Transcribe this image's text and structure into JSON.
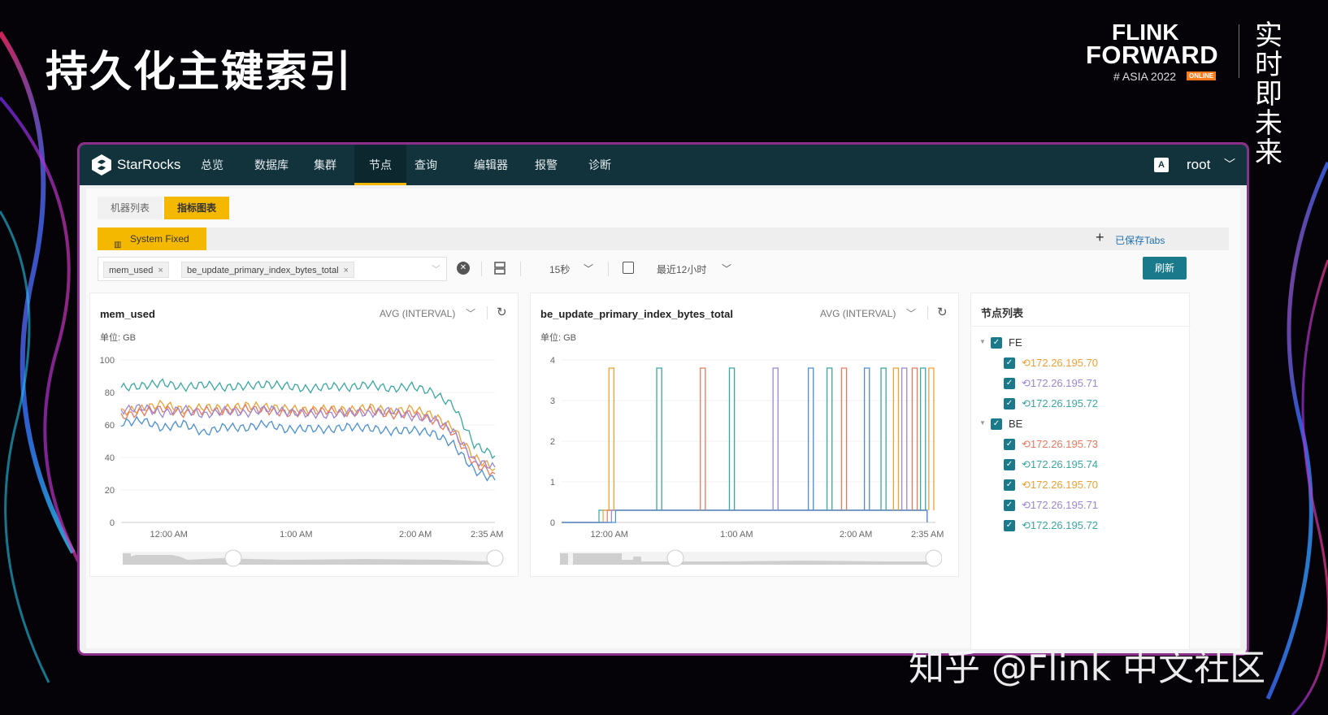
{
  "slide": {
    "title": "持久化主键索引",
    "watermark": "知乎 @Flink 中文社区"
  },
  "brand": {
    "line1": "FLINK",
    "line2": "FORWARD",
    "line3": "# ASIA 2022",
    "badge": "ONLINE",
    "cn": "实时即未来"
  },
  "app": {
    "name": "StarRocks",
    "nav": [
      {
        "label": "总览",
        "active": false
      },
      {
        "label": "数据库",
        "active": false
      },
      {
        "label": "集群",
        "active": false
      },
      {
        "label": "节点",
        "active": true
      },
      {
        "label": "查询",
        "active": false
      },
      {
        "label": "编辑器",
        "active": false
      },
      {
        "label": "报警",
        "active": false
      },
      {
        "label": "诊断",
        "active": false
      }
    ],
    "user": "root",
    "user_icon": "translate-icon"
  },
  "subtabs": [
    "机器列表",
    "指标图表"
  ],
  "tabs": {
    "system_fixed": "System Fixed",
    "add": "+",
    "saved": "已保存Tabs"
  },
  "filters": {
    "chips": [
      "mem_used",
      "be_update_primary_index_bytes_total"
    ],
    "chip_remove": "×",
    "interval": "15秒",
    "range": "最近12小时",
    "refresh": "刷新"
  },
  "colors": {
    "teal": "#3aa7a0",
    "orange": "#f0a033",
    "coral": "#e8795e",
    "purple": "#9b86d8",
    "blue": "#4a8fd4",
    "accent": "#f5b800",
    "header": "#13333c"
  },
  "panels": [
    {
      "title": "mem_used",
      "agg": "AVG (INTERVAL)",
      "unit": "单位: GB"
    },
    {
      "title": "be_update_primary_index_bytes_total",
      "agg": "AVG (INTERVAL)",
      "unit": "单位: GB"
    }
  ],
  "chart_data": [
    {
      "type": "line",
      "title": "mem_used",
      "ylabel": "单位: GB",
      "ylim": [
        0,
        100
      ],
      "yticks": [
        "100",
        "80",
        "60",
        "40",
        "20",
        "0"
      ],
      "xticks": [
        "12:00 AM",
        "1:00 AM",
        "2:00 AM",
        "2:35 AM"
      ],
      "x": [
        0,
        10,
        20,
        30,
        40,
        50,
        60,
        70,
        80,
        90,
        100,
        110,
        120,
        130,
        140,
        150,
        160,
        170,
        180
      ],
      "series": [
        {
          "values": [
            83,
            84,
            86,
            83,
            85,
            83,
            84,
            85,
            84,
            82,
            84,
            83,
            85,
            82,
            84,
            80,
            72,
            48,
            41
          ]
        },
        {
          "values": [
            68,
            70,
            73,
            69,
            71,
            70,
            72,
            71,
            70,
            69,
            70,
            69,
            71,
            68,
            70,
            66,
            58,
            40,
            33
          ]
        },
        {
          "values": [
            65,
            68,
            70,
            67,
            69,
            68,
            70,
            69,
            67,
            68,
            69,
            67,
            69,
            66,
            67,
            63,
            55,
            36,
            30
          ]
        },
        {
          "values": [
            69,
            71,
            67,
            70,
            66,
            69,
            67,
            70,
            68,
            67,
            66,
            68,
            67,
            69,
            65,
            64,
            56,
            38,
            34
          ]
        },
        {
          "values": [
            61,
            63,
            58,
            61,
            55,
            59,
            58,
            61,
            57,
            58,
            57,
            59,
            58,
            56,
            57,
            55,
            48,
            32,
            26
          ]
        }
      ]
    },
    {
      "type": "line",
      "title": "be_update_primary_index_bytes_total",
      "ylabel": "单位: GB",
      "ylim": [
        0,
        4
      ],
      "yticks": [
        "4",
        "3",
        "2",
        "1",
        "0"
      ],
      "xticks": [
        "12:00 AM",
        "1:00 AM",
        "2:00 AM",
        "2:35 AM"
      ],
      "x": [
        0,
        180
      ],
      "series": [
        {
          "values": [
            0.3,
            0.3
          ]
        },
        {
          "values": [
            0.3,
            0.3
          ]
        },
        {
          "values": [
            0.3,
            0.3
          ]
        },
        {
          "values": [
            0.3,
            0.3
          ]
        },
        {
          "values": [
            0.3,
            0.3
          ]
        }
      ],
      "spikes": [
        {
          "x": 24,
          "y": 3.8,
          "series": 1
        },
        {
          "x": 47,
          "y": 3.8,
          "series": 0
        },
        {
          "x": 68,
          "y": 3.8,
          "series": 2
        },
        {
          "x": 82,
          "y": 3.8,
          "series": 0
        },
        {
          "x": 103,
          "y": 3.8,
          "series": 3
        },
        {
          "x": 120,
          "y": 3.8,
          "series": 4
        },
        {
          "x": 129,
          "y": 3.8,
          "series": 0
        },
        {
          "x": 136,
          "y": 3.8,
          "series": 2
        },
        {
          "x": 147,
          "y": 3.8,
          "series": 4
        },
        {
          "x": 155,
          "y": 3.8,
          "series": 0
        },
        {
          "x": 161,
          "y": 3.8,
          "series": 1
        },
        {
          "x": 165,
          "y": 3.8,
          "series": 3
        },
        {
          "x": 170,
          "y": 3.8,
          "series": 2
        },
        {
          "x": 174,
          "y": 3.8,
          "series": 0
        },
        {
          "x": 178,
          "y": 3.8,
          "series": 1
        }
      ]
    }
  ],
  "nodes": {
    "title": "节点列表",
    "groups": [
      {
        "name": "FE",
        "items": [
          {
            "label": "172.26.195.70",
            "color": "#f0a033"
          },
          {
            "label": "172.26.195.71",
            "color": "#9b86d8"
          },
          {
            "label": "172.26.195.72",
            "color": "#3aa7a0"
          }
        ]
      },
      {
        "name": "BE",
        "items": [
          {
            "label": "172.26.195.73",
            "color": "#e8795e"
          },
          {
            "label": "172.26.195.74",
            "color": "#3aa7a0"
          },
          {
            "label": "172.26.195.70",
            "color": "#f0a033"
          },
          {
            "label": "172.26.195.71",
            "color": "#9b86d8"
          },
          {
            "label": "172.26.195.72",
            "color": "#3aa7a0"
          }
        ]
      }
    ]
  }
}
